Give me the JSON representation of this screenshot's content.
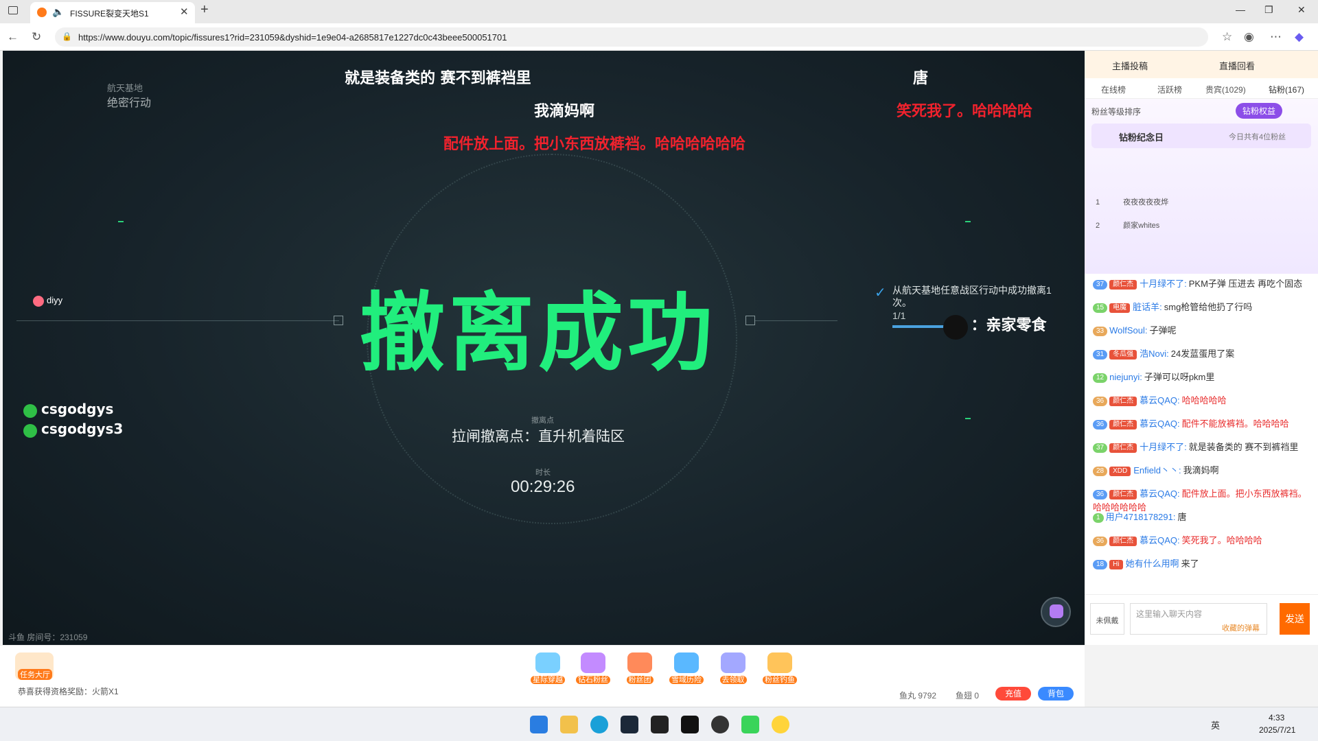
{
  "browser": {
    "tab_title": "FISSURE裂变天地S1",
    "url": "https://www.douyu.com/topic/fissures1?rid=231059&dyshid=1e9e04-a2685817e1227dc0c43beee500051701"
  },
  "video": {
    "location_small": "航天基地",
    "location_big": "绝密行动",
    "big_title": "撤离成功",
    "extract_label": "撤离点",
    "extract_value": "拉闸撤离点：直升机着陆区",
    "duration_label": "时长",
    "duration_value": "00:29:26",
    "mission_text": "从航天基地任意战区行动中成功撤离1次。",
    "mission_progress": "1/1",
    "player_name": "diyy",
    "room_label": "斗鱼 房间号：231059",
    "wechat_1": "csgodgys",
    "wechat_2": "csgodgys3",
    "watermark": "：亲家零食",
    "danmu": [
      {
        "text": "就是装备类的 赛不到裤裆里",
        "color": "white"
      },
      {
        "text": "我滴妈啊",
        "color": "white"
      },
      {
        "text": "配件放上面。把小东西放裤裆。哈哈哈哈哈哈",
        "color": "red"
      },
      {
        "text": "唐",
        "color": "white"
      },
      {
        "text": "笑死我了。哈哈哈哈",
        "color": "red"
      }
    ]
  },
  "sidebar": {
    "top_links": [
      "主播投稿",
      "直播回看"
    ],
    "tabs": [
      "在线榜",
      "活跃榜",
      "贵宾(1029)",
      "钻粉(167)"
    ],
    "rank_label": "粉丝等级排序",
    "fan_benefit": "钻粉权益",
    "fan_day_title": "钻粉纪念日",
    "fan_day_count": "今日共有4位粉丝",
    "fan_list": [
      {
        "rank": "1",
        "name": "夜夜夜夜夜烨"
      },
      {
        "rank": "2",
        "name": "颜家whites"
      }
    ],
    "messages": [
      {
        "lvl": "37",
        "medal": "颜仁杰",
        "user": "十月绿不了:",
        "text": "PKM子弹 压进去 再吃个固态",
        "red": false
      },
      {
        "lvl": "15",
        "medal": "电魔",
        "user": "脏话羊:",
        "text": "smg枪管给他扔了行吗",
        "red": false
      },
      {
        "lvl": "33",
        "medal": "",
        "user": "WolfSoul:",
        "text": "子弹呢",
        "red": false
      },
      {
        "lvl": "31",
        "medal": "冬瓜强",
        "user": "浩Novi:",
        "text": "24发蓝蛋甩了案",
        "red": false
      },
      {
        "lvl": "12",
        "medal": "",
        "user": "niejunyi:",
        "text": "子弹可以呀pkm里",
        "red": false
      },
      {
        "lvl": "36",
        "medal": "颜仁杰",
        "user": "慕云QAQ:",
        "text": "哈哈哈哈哈",
        "red": true
      },
      {
        "lvl": "36",
        "medal": "颜仁杰",
        "user": "慕云QAQ:",
        "text": "配件不能放裤裆。哈哈哈哈",
        "red": true
      },
      {
        "lvl": "37",
        "medal": "颜仁杰",
        "user": "十月绿不了:",
        "text": "就是装备类的 赛不到裤裆里",
        "red": false
      },
      {
        "lvl": "28",
        "medal": "XDD",
        "user": "Enfield丶丶:",
        "text": "我滴妈啊",
        "red": false
      },
      {
        "lvl": "36",
        "medal": "颜仁杰",
        "user": "慕云QAQ:",
        "text": "配件放上面。把小东西放裤裆。哈哈哈哈哈哈",
        "red": true
      },
      {
        "lvl": "1",
        "medal": "",
        "user": "用户4718178291:",
        "text": "唐",
        "red": false
      },
      {
        "lvl": "36",
        "medal": "颜仁杰",
        "user": "慕云QAQ:",
        "text": "笑死我了。哈哈哈哈",
        "red": true
      },
      {
        "lvl": "18",
        "medal": "Hi",
        "user": "她有什么用啊",
        "text": "来了",
        "red": false
      }
    ],
    "chat_placeholder": "这里输入聊天内容",
    "chat_hint": "收藏的弹幕",
    "send_label": "发送",
    "login_label": "未佩戴"
  },
  "giftbar": {
    "task_label": "任务大厅",
    "notice": "恭喜获得资格奖励：火箭X1",
    "gifts": [
      "星际穿越",
      "钻石粉丝",
      "粉丝团",
      "雪域历险",
      "去领取",
      "粉丝钓鱼"
    ],
    "yuwan_label": "鱼丸",
    "yuwan": "9792",
    "yuchi_label": "鱼翅",
    "yuchi": "0",
    "recharge": "充值",
    "backpack": "背包"
  },
  "taskbar": {
    "time": "4:33",
    "date": "2025/7/21",
    "ime": "英"
  }
}
